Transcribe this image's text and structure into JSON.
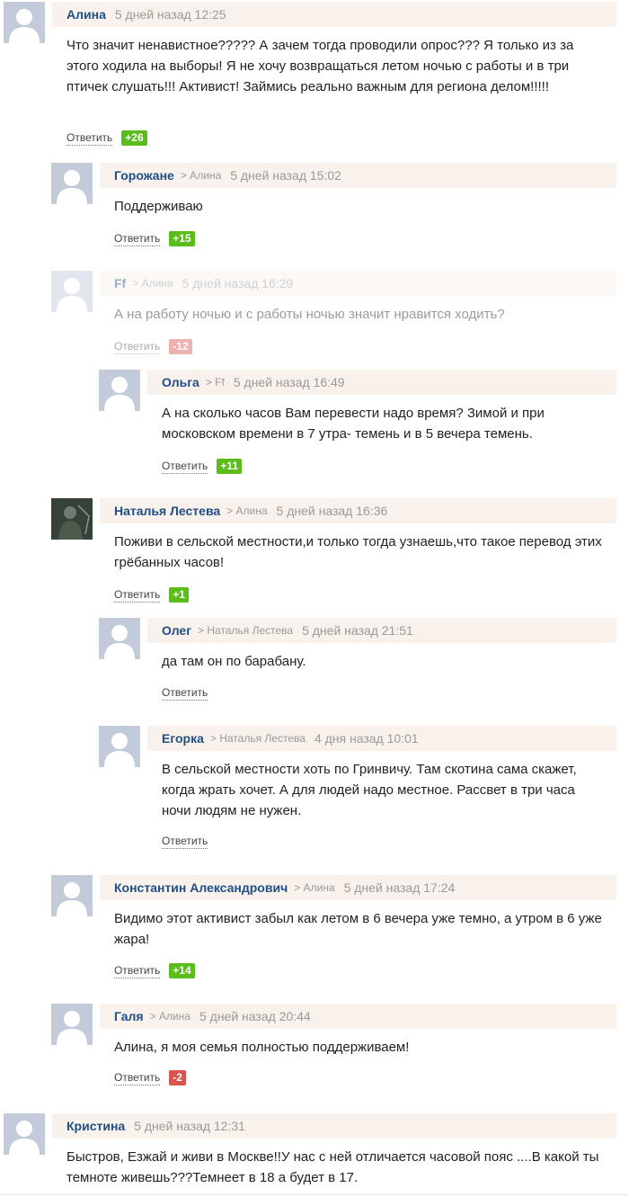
{
  "reply_label": "Ответить",
  "comments": [
    {
      "author": "Алина",
      "reply_to": "",
      "date": "5 дней назад 12:25",
      "text": "Что значит ненавистное????? А зачем тогда проводили опрос??? Я только из за этого ходила на выборы! Я не хочу возвращаться летом ночью с работы и в три птичек слушать!!! Активист! Займись реально важным для региона делом!!!!!",
      "rating": "+26",
      "avatar": "default-avatar"
    },
    {
      "author": "Горожане",
      "reply_to": "> Алина",
      "date": "5 дней назад 15:02",
      "text": "Поддерживаю",
      "rating": "+15",
      "avatar": "default-avatar"
    },
    {
      "author": "Ff",
      "reply_to": "> Алина",
      "date": "5 дней назад 16:29",
      "text": "А на работу ночью и с работы ночью значит нравится ходить?",
      "rating": "-12",
      "avatar": "default-avatar"
    },
    {
      "author": "Ольга",
      "reply_to": "> Ff",
      "date": "5 дней назад 16:49",
      "text": "А на сколько часов Вам перевести надо время? Зимой и при московском времени в 7 утра- темень и в 5 вечера темень.",
      "rating": "+11",
      "avatar": "default-avatar"
    },
    {
      "author": "Наталья Лестева",
      "reply_to": "> Алина",
      "date": "5 дней назад 16:36",
      "text": "Поживи в сельской местности,и только тогда узнаешь,что такое перевод этих грёбанных часов!",
      "rating": "+1",
      "avatar": "photo-avatar"
    },
    {
      "author": "Олег",
      "reply_to": "> Наталья Лестева",
      "date": "5 дней назад 21:51",
      "text": "да там он по барабану.",
      "rating": "",
      "avatar": "default-avatar"
    },
    {
      "author": "Егорка",
      "reply_to": "> Наталья Лестева",
      "date": "4 дня назад 10:01",
      "text": "В сельской местности хоть по Гринвичу. Там скотина сама скажет, когда жрать хочет. А для людей надо местное. Рассвет в три часа ночи людям не нужен.",
      "rating": "",
      "avatar": "default-avatar"
    },
    {
      "author": "Константин Александрович",
      "reply_to": "> Алина",
      "date": "5 дней назад 17:24",
      "text": "Видимо этот активист забыл как летом в 6 вечера уже темно, а утром в 6 уже жара!",
      "rating": "+14",
      "avatar": "default-avatar"
    },
    {
      "author": "Галя",
      "reply_to": "> Алина",
      "date": "5 дней назад 20:44",
      "text": "Алина, я моя семья полностью поддерживаем!",
      "rating": "-2",
      "avatar": "default-avatar"
    },
    {
      "author": "Кристина",
      "reply_to": "",
      "date": "5 дней назад 12:31",
      "text": "Быстров, Езжай и живи в Москве!!У нас с ней отличается часовой пояс ....В какой ты темноте живешь???Темнеет в 18 а будет в 17.",
      "rating": "",
      "avatar": "default-avatar"
    }
  ]
}
